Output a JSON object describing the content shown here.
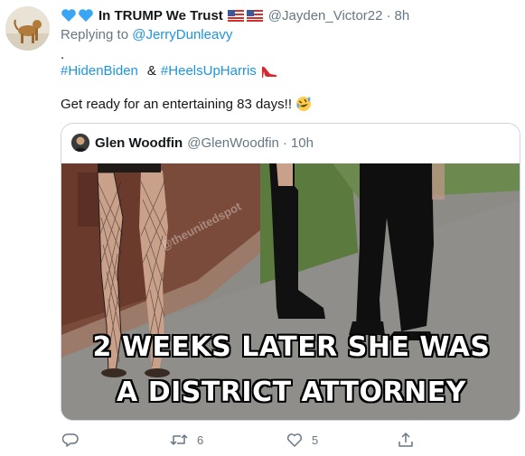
{
  "tweet": {
    "display_name": "In TRUMP We Trust",
    "handle": "@Jayden_Victor22",
    "separator": "·",
    "time": "8h",
    "replying_prefix": "Replying to ",
    "replying_mention": "@JerryDunleavy",
    "period_line": ".",
    "hashtag_1": "#HidenBiden",
    "amp": "&",
    "hashtag_2": "#HeelsUpHarris",
    "text": "Get ready for an entertaining 83 days!!",
    "icons": {
      "hearts": "blue-heart-icon",
      "flags": "us-flag-icon",
      "heel": "high-heel-icon",
      "emoji": "rolling-laughing-emoji-icon"
    }
  },
  "quoted": {
    "display_name": "Glen Woodfin",
    "handle": "@GlenWoodfin",
    "separator": "·",
    "time": "10h",
    "media": {
      "caption_line_1": "2 WEEKS LATER SHE WAS",
      "caption_line_2": "A DISTRICT ATTORNEY",
      "watermark": "@theunitedspot"
    }
  },
  "actions": {
    "reply": {
      "icon": "reply-icon",
      "count": ""
    },
    "retweet": {
      "icon": "retweet-icon",
      "count": "6"
    },
    "like": {
      "icon": "heart-outline-icon",
      "count": "5"
    },
    "share": {
      "icon": "share-icon",
      "count": ""
    }
  },
  "colors": {
    "link": "#1b95e0",
    "secondary_text": "#657786",
    "border": "#ccd6dd",
    "heart_blue": "#3ba5f5"
  }
}
